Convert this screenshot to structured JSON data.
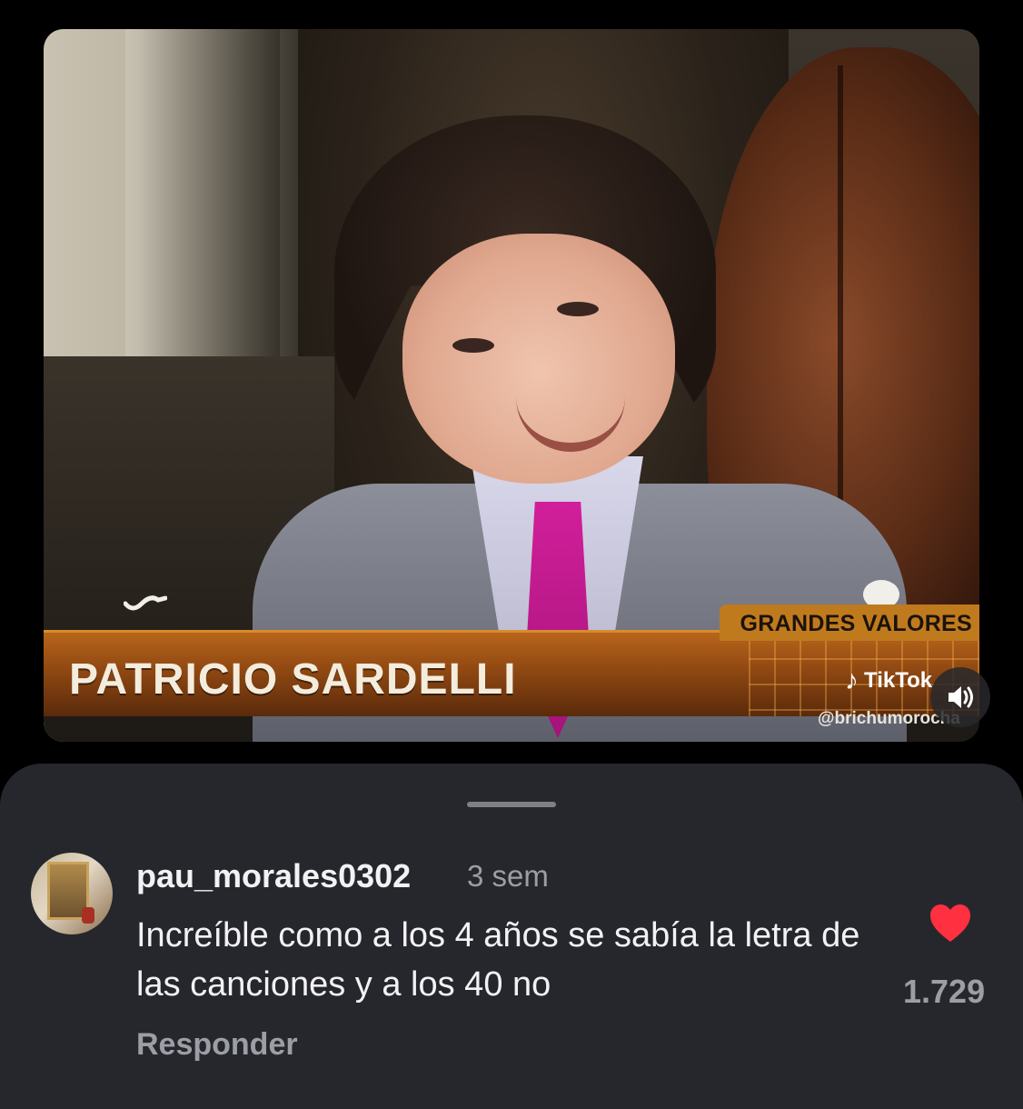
{
  "video": {
    "program_tag": "GRANDES VALORES",
    "name_caption": "PATRICIO SARDELLI",
    "watermark_brand": "TikTok",
    "watermark_handle": "@brichumorocha",
    "sound_icon": "speaker-on-icon"
  },
  "comment": {
    "username": "pau_morales0302",
    "time": "3 sem",
    "text": "Increíble como a los 4 años se sabía la letra de las canciones y a los 40 no",
    "reply_label": "Responder",
    "like_count": "1.729",
    "like_icon": "heart-icon",
    "like_color": "#ff3040"
  }
}
